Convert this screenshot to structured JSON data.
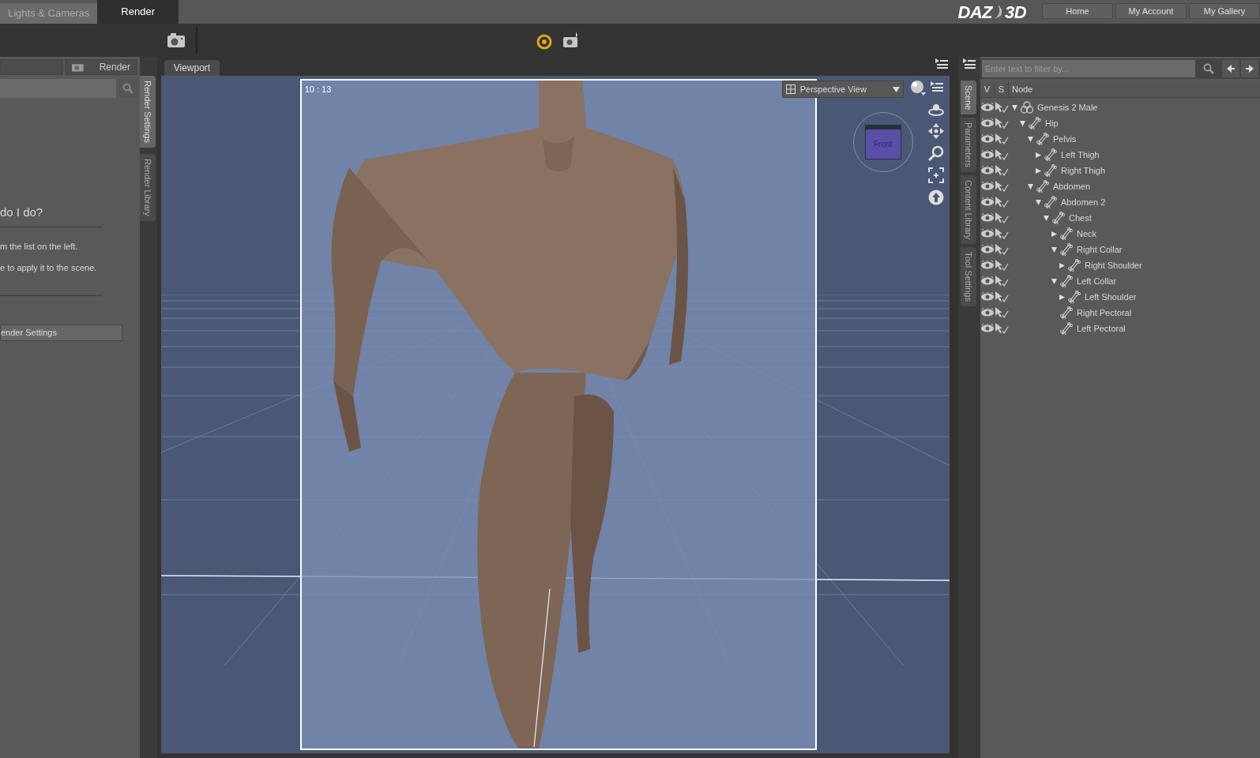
{
  "top_tabs": [
    {
      "label": "Lights & Cameras",
      "selected": false
    },
    {
      "label": "Render",
      "selected": true
    }
  ],
  "logo": {
    "left": "DAZ",
    "right": "3D"
  },
  "header_links": [
    "Home",
    "My Account",
    "My Gallery"
  ],
  "left_panel": {
    "render_button": "Render",
    "heading": "do I do?",
    "lines": [
      "m the list on the left.",
      "e to apply it to the scene."
    ],
    "button": "ender Settings"
  },
  "left_side_tabs": [
    {
      "label": "Render Settings",
      "selected": true
    },
    {
      "label": "Render Library",
      "selected": false
    }
  ],
  "viewport": {
    "tab": "Viewport",
    "time": "10 : 13",
    "view_menu": "Perspective View",
    "cube_label": "Front"
  },
  "right_side_tabs": [
    {
      "label": "Scene",
      "selected": true
    },
    {
      "label": "Parameters",
      "selected": false
    },
    {
      "label": "Content Library",
      "selected": false
    },
    {
      "label": "Tool Settings",
      "selected": false
    }
  ],
  "scene": {
    "filter_placeholder": "Enter text to filter by...",
    "columns": [
      "V",
      "S",
      "Node"
    ],
    "tree": [
      {
        "label": "Genesis 2 Male",
        "kind": "figure",
        "expanded": true,
        "children": [
          {
            "label": "Hip",
            "kind": "bone",
            "expanded": true,
            "children": [
              {
                "label": "Pelvis",
                "kind": "bone",
                "expanded": true,
                "children": [
                  {
                    "label": "Left Thigh",
                    "kind": "bone",
                    "expanded": false
                  },
                  {
                    "label": "Right Thigh",
                    "kind": "bone",
                    "expanded": false
                  }
                ]
              },
              {
                "label": "Abdomen",
                "kind": "bone",
                "expanded": true,
                "children": [
                  {
                    "label": "Abdomen 2",
                    "kind": "bone",
                    "expanded": true,
                    "children": [
                      {
                        "label": "Chest",
                        "kind": "bone",
                        "expanded": true,
                        "children": [
                          {
                            "label": "Neck",
                            "kind": "bone",
                            "expanded": false
                          },
                          {
                            "label": "Right Collar",
                            "kind": "bone",
                            "expanded": true,
                            "children": [
                              {
                                "label": "Right Shoulder",
                                "kind": "bone",
                                "expanded": false
                              }
                            ]
                          },
                          {
                            "label": "Left Collar",
                            "kind": "bone",
                            "expanded": true,
                            "children": [
                              {
                                "label": "Left Shoulder",
                                "kind": "bone",
                                "expanded": false
                              }
                            ]
                          },
                          {
                            "label": "Right Pectoral",
                            "kind": "bone"
                          },
                          {
                            "label": "Left Pectoral",
                            "kind": "bone"
                          }
                        ]
                      }
                    ]
                  }
                ]
              }
            ]
          }
        ]
      }
    ]
  }
}
